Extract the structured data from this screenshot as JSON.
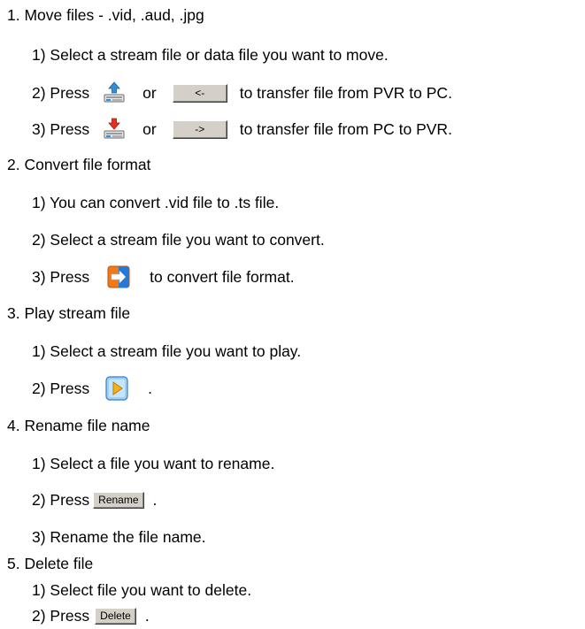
{
  "sections": [
    {
      "heading": "1. Move files - .vid, .aud, .jpg",
      "steps": {
        "s1": "1) Select a stream file or data file you want to move.",
        "s2_prefix": "2) Press",
        "s2_or": "or",
        "s2_suffix": "to transfer file from PVR to PC.",
        "s3_prefix": "3) Press",
        "s3_or": "or",
        "s3_suffix": "to transfer file from PC to PVR."
      },
      "buttons": {
        "left_arrow": "<-",
        "right_arrow": "->"
      }
    },
    {
      "heading": "2. Convert file format",
      "steps": {
        "s1": "1) You can convert .vid file to .ts file.",
        "s2": "2) Select a stream file you want to convert.",
        "s3_prefix": "3) Press",
        "s3_suffix": "to convert file format."
      }
    },
    {
      "heading": "3. Play stream file",
      "steps": {
        "s1": "1) Select a stream file you want to play.",
        "s2_prefix": "2) Press",
        "s2_suffix": "."
      }
    },
    {
      "heading": "4. Rename file name",
      "steps": {
        "s1": "1) Select a file you want to rename.",
        "s2_prefix": "2) Press",
        "s2_suffix": ".",
        "s3": "3) Rename the file name."
      },
      "buttons": {
        "rename": "Rename"
      }
    },
    {
      "heading": "5. Delete file",
      "steps": {
        "s1": "1) Select file you want to delete.",
        "s2_prefix": "2) Press",
        "s2_suffix": "."
      },
      "buttons": {
        "delete": "Delete"
      }
    }
  ],
  "icons": {
    "upload": "pvr-upload-icon",
    "download": "pvr-download-icon",
    "convert": "convert-icon",
    "play": "play-icon"
  },
  "colors": {
    "button_face": "#d4d0c8",
    "upload_arrow": "#2f8fd8",
    "download_arrow": "#e8301c",
    "convert_orange": "#f07a1a",
    "convert_blue": "#2a78d6",
    "play_bg": "#9fd0f5",
    "play_triangle": "#f3b21a"
  }
}
